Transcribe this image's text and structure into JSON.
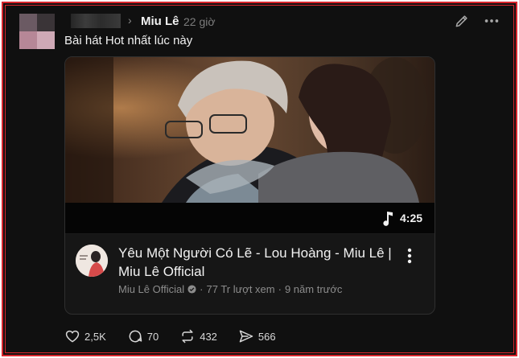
{
  "post": {
    "author": "Miu Lê",
    "time": "22 giờ",
    "text": "Bài hát Hot nhất lúc này"
  },
  "video": {
    "duration": "4:25",
    "title": "Yêu Một Người Có Lẽ - Lou Hoàng - Miu Lê | Miu Lê Official",
    "channel": "Miu Lê Official",
    "views": "77 Tr lượt xem",
    "age": "9 năm trước",
    "separator": "·"
  },
  "actions": {
    "likes": "2,5K",
    "comments": "70",
    "reposts": "432",
    "shares": "566"
  },
  "colors": {
    "background": "#101010",
    "border": "#d9262c",
    "text_primary": "#f2f2f2",
    "text_secondary": "#8c8c8c"
  },
  "icons": [
    "chevron-right-icon",
    "edit-icon",
    "more-icon",
    "music-note-icon",
    "kebab-icon",
    "verified-icon",
    "heart-icon",
    "comment-icon",
    "repost-icon",
    "share-icon"
  ]
}
